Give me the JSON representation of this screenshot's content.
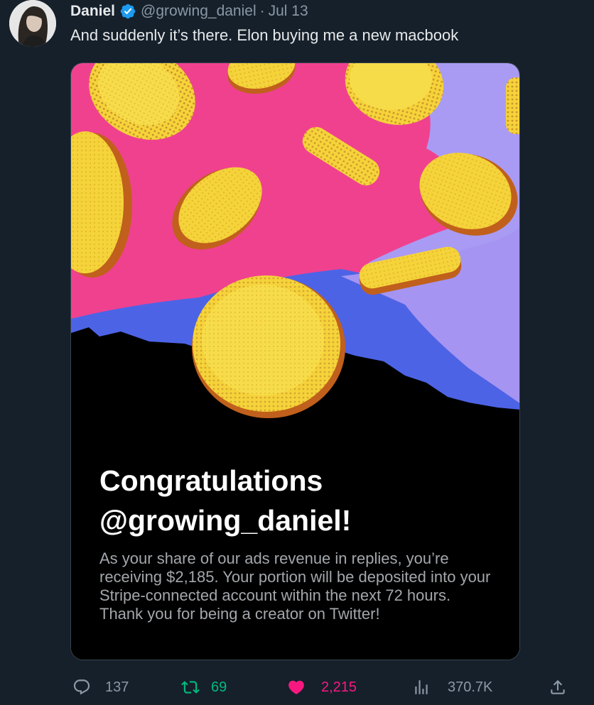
{
  "tweet": {
    "author_name": "Daniel",
    "handle": "@growing_daniel",
    "separator": "·",
    "date": "Jul 13",
    "text": "And suddenly it’s there. Elon buying me a new macbook"
  },
  "card": {
    "title_line1": "Congratulations",
    "title_line2": "@growing_daniel!",
    "body": "As your share of our ads revenue in replies, you’re receiving $2,185. Your portion will be deposited into your Stripe-connected account within the next 72 hours. Thank you for being a creator on Twitter!"
  },
  "actions": {
    "replies": "137",
    "retweets": "69",
    "likes": "2,215",
    "views": "370.7K"
  },
  "icons": [
    "verified-badge-icon",
    "reply-icon",
    "retweet-icon",
    "like-icon",
    "views-icon",
    "share-icon"
  ],
  "colors": {
    "background": "#15202b",
    "verified": "#1d9bf0",
    "retweet": "#00ba7c",
    "like": "#f91880",
    "muted": "#8b98a5",
    "coin": "#f5d33a",
    "pink": "#f0418f",
    "purple": "#9b8cf0",
    "blue": "#4c63e6"
  }
}
